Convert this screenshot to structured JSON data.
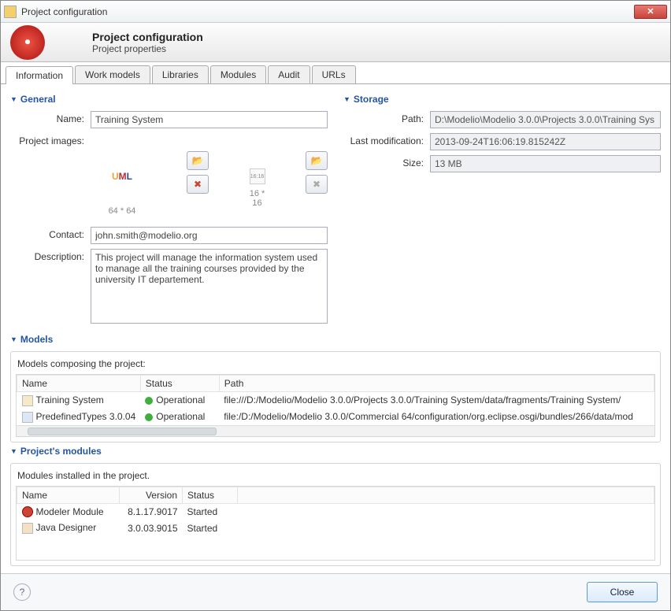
{
  "window": {
    "title": "Project configuration"
  },
  "banner": {
    "title": "Project configuration",
    "subtitle": "Project properties"
  },
  "tabs": [
    "Information",
    "Work models",
    "Libraries",
    "Modules",
    "Audit",
    "URLs"
  ],
  "general": {
    "title": "General",
    "name_label": "Name:",
    "name_value": "Training System",
    "images_label": "Project images:",
    "img64_caption": "64 * 64",
    "img16_caption": "16 * 16",
    "contact_label": "Contact:",
    "contact_value": "john.smith@modelio.org",
    "description_label": "Description:",
    "description_value": "This project will manage the information system used to manage all the training courses provided by the university IT departement."
  },
  "storage": {
    "title": "Storage",
    "path_label": "Path:",
    "path_value": "D:\\Modelio\\Modelio 3.0.0\\Projects 3.0.0\\Training Sys",
    "mod_label": "Last modification:",
    "mod_value": "2013-09-24T16:06:19.815242Z",
    "size_label": "Size:",
    "size_value": "13 MB"
  },
  "models": {
    "title": "Models",
    "subtitle": "Models composing the project:",
    "headers": {
      "name": "Name",
      "status": "Status",
      "path": "Path"
    },
    "rows": [
      {
        "name": "Training System",
        "status": "Operational",
        "path": "file:///D:/Modelio/Modelio 3.0.0/Projects 3.0.0/Training System/data/fragments/Training System/"
      },
      {
        "name": "PredefinedTypes 3.0.04",
        "status": "Operational",
        "path": "file:/D:/Modelio/Modelio 3.0.0/Commercial 64/configuration/org.eclipse.osgi/bundles/266/data/mod"
      }
    ]
  },
  "modules": {
    "title": "Project's modules",
    "subtitle": "Modules installed in the project.",
    "headers": {
      "name": "Name",
      "version": "Version",
      "status": "Status"
    },
    "rows": [
      {
        "name": "Modeler Module",
        "version": "8.1.17.9017",
        "status": "Started"
      },
      {
        "name": "Java Designer",
        "version": "3.0.03.9015",
        "status": "Started"
      }
    ]
  },
  "footer": {
    "close": "Close"
  },
  "icons": {
    "browse": "📂",
    "delete": "✖",
    "small_placeholder": "16:16"
  }
}
